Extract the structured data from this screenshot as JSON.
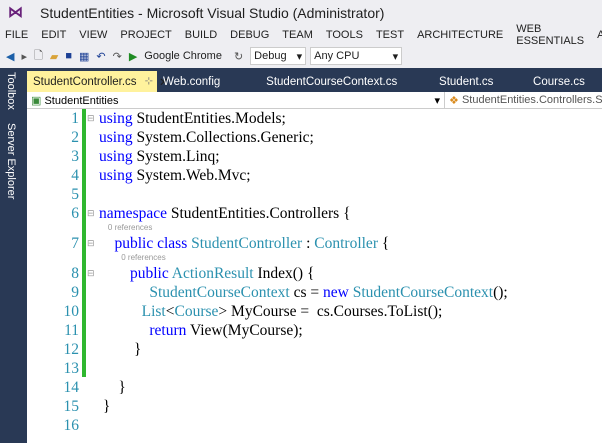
{
  "window": {
    "title": "StudentEntities - Microsoft Visual Studio (Administrator)"
  },
  "menu": [
    "FILE",
    "EDIT",
    "VIEW",
    "PROJECT",
    "BUILD",
    "DEBUG",
    "TEAM",
    "TOOLS",
    "TEST",
    "ARCHITECTURE",
    "WEB ESSENTIALS",
    "AN"
  ],
  "toolbar": {
    "browser": "Google Chrome",
    "config": "Debug",
    "platform": "Any CPU"
  },
  "sidebar": {
    "toolbox": "Toolbox",
    "server_explorer": "Server Explorer"
  },
  "tabs": [
    "StudentController.cs",
    "Web.config",
    "StudentCourseContext.cs",
    "Student.cs",
    "Course.cs"
  ],
  "nav": {
    "project": "StudentEntities",
    "class": "StudentEntities.Controllers.Stu"
  },
  "code": [
    {
      "n": "1",
      "fold": "⊟",
      "t": [
        [
          "using",
          "kw"
        ],
        [
          " StudentEntities.Models;",
          ""
        ]
      ]
    },
    {
      "n": "2",
      "t": [
        [
          "using",
          "kw"
        ],
        [
          " System.Collections.Generic;",
          ""
        ]
      ]
    },
    {
      "n": "3",
      "t": [
        [
          "using",
          "kw"
        ],
        [
          " System.Linq;",
          ""
        ]
      ]
    },
    {
      "n": "4",
      "t": [
        [
          "using",
          "kw"
        ],
        [
          " System.Web.Mvc;",
          ""
        ]
      ]
    },
    {
      "n": "5",
      "t": []
    },
    {
      "n": "6",
      "fold": "⊟",
      "t": [
        [
          "namespace",
          "kw"
        ],
        [
          " StudentEntities.Controllers {",
          ""
        ]
      ]
    },
    {
      "n": "7",
      "fold": "⊟",
      "lens": "    0 references",
      "t": [
        [
          "    public class ",
          "kw"
        ],
        [
          "StudentController",
          "ty"
        ],
        [
          " : ",
          ""
        ],
        [
          "Controller",
          "ty"
        ],
        [
          " {",
          ""
        ]
      ]
    },
    {
      "n": "8",
      "fold": "⊟",
      "lens": "          0 references",
      "t": [
        [
          "        public ",
          "kw"
        ],
        [
          "ActionResult",
          "ty"
        ],
        [
          " Index() {",
          ""
        ]
      ]
    },
    {
      "n": "9",
      "t": [
        [
          "             ",
          ""
        ],
        [
          "StudentCourseContext",
          "ty"
        ],
        [
          " cs = ",
          ""
        ],
        [
          "new ",
          "kw"
        ],
        [
          "StudentCourseContext",
          "ty"
        ],
        [
          "();",
          ""
        ]
      ]
    },
    {
      "n": "10",
      "t": [
        [
          "           ",
          ""
        ],
        [
          "List",
          "ty"
        ],
        [
          "<",
          ""
        ],
        [
          "Course",
          "ty"
        ],
        [
          "> MyCourse =  cs.Courses.ToList();",
          ""
        ]
      ]
    },
    {
      "n": "11",
      "t": [
        [
          "             ",
          ""
        ],
        [
          "return",
          "kw"
        ],
        [
          " View(MyCourse);",
          ""
        ]
      ]
    },
    {
      "n": "12",
      "t": [
        [
          "         }",
          ""
        ]
      ]
    },
    {
      "n": "13",
      "t": []
    },
    {
      "n": "14",
      "t": [
        [
          "     }",
          ""
        ]
      ]
    },
    {
      "n": "15",
      "t": [
        [
          " }",
          ""
        ]
      ]
    },
    {
      "n": "16",
      "t": []
    }
  ]
}
